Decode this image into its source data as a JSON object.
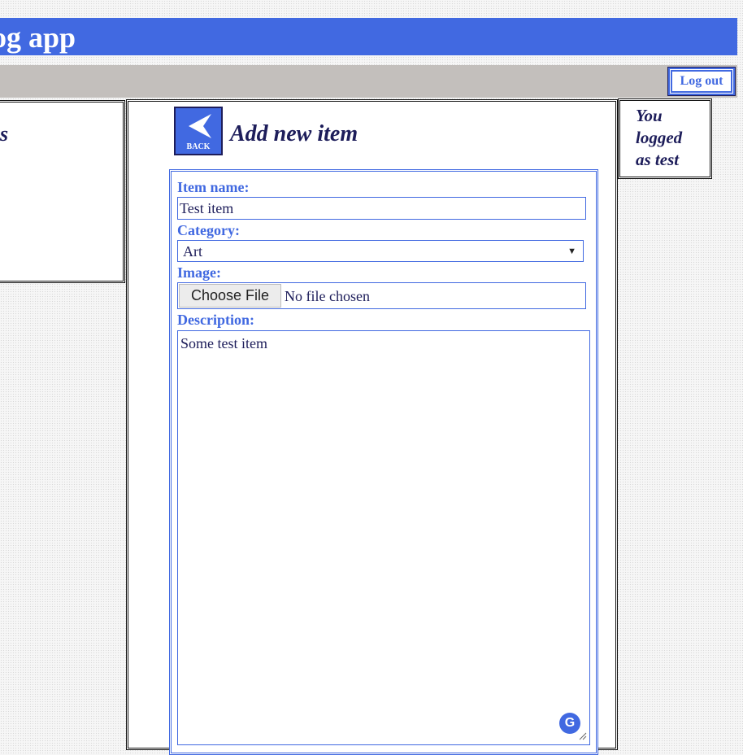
{
  "header": {
    "title": "log app"
  },
  "nav": {
    "logout_label": "Log out"
  },
  "left_panel": {
    "visible_fragment": "s"
  },
  "main": {
    "back_label": "BACK",
    "title": "Add new item",
    "form": {
      "item_name_label": "Item name:",
      "item_name_value": "Test item",
      "category_label": "Category:",
      "category_selected": "Art",
      "image_label": "Image:",
      "file_button_label": "Choose File",
      "file_status": "No file chosen",
      "description_label": "Description:",
      "description_value": "Some test item"
    }
  },
  "user_panel": {
    "text": "You logged as test"
  },
  "colors": {
    "accent": "#4169e1",
    "dark_text": "#1d1d5a",
    "nav_bg": "#c3bfbc"
  },
  "icons": {
    "back": "back-arrow-icon",
    "grammarly": "grammarly-icon"
  }
}
